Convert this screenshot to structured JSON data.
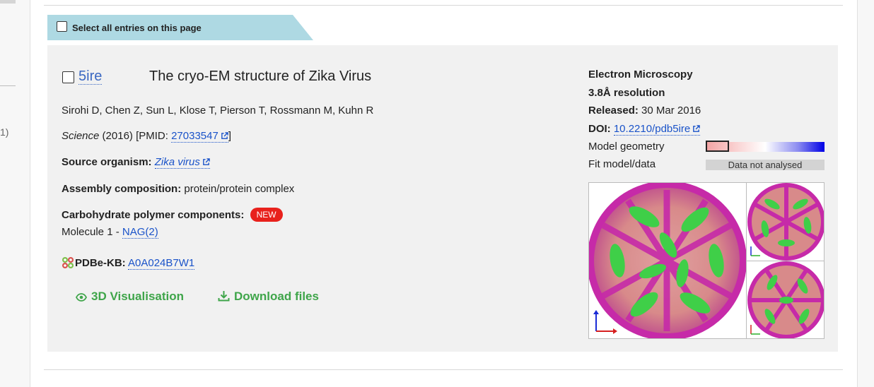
{
  "left_panel": {
    "number_fragment": "1)"
  },
  "select_all": {
    "label": "Select all entries on this page"
  },
  "entry": {
    "pdb_id": "5ire",
    "title": "The cryo-EM structure of Zika Virus",
    "authors": "Sirohi D, Chen Z, Sun L, Klose T, Pierson T, Rossmann M, Kuhn R",
    "citation": {
      "journal": "Science",
      "year_text": " (2016) [PMID: ",
      "pmid": "27033547",
      "close": "]"
    },
    "source_organism": {
      "label": "Source organism:",
      "value": "Zika virus"
    },
    "assembly": {
      "label": "Assembly composition:",
      "value": "protein/protein complex"
    },
    "carbohydrate": {
      "label": "Carbohydrate polymer components:",
      "badge": "NEW",
      "molecule_prefix": "Molecule 1 - ",
      "molecule_link": "NAG(2)"
    },
    "pdbe_kb": {
      "label": "PDBe-KB:",
      "value": "A0A024B7W1"
    },
    "actions": {
      "visualisation": "3D Visualisation",
      "download": "Download files"
    }
  },
  "meta": {
    "method": "Electron Microscopy",
    "resolution": "3.8Å resolution",
    "released_label": "Released:",
    "released_value": "30 Mar 2016",
    "doi_label": "DOI:",
    "doi_value": "10.2210/pdb5ire",
    "model_geometry_label": "Model geometry",
    "fit_label": "Fit model/data",
    "fit_value": "Data not analysed"
  },
  "colors": {
    "accent_green": "#3fa54a",
    "link_blue": "#1a53c9",
    "badge_red": "#e8211c",
    "select_bar": "#aed9e3"
  },
  "icons": [
    "external-link-icon",
    "eye-icon",
    "download-icon",
    "pdbe-kb-logo-icon"
  ]
}
